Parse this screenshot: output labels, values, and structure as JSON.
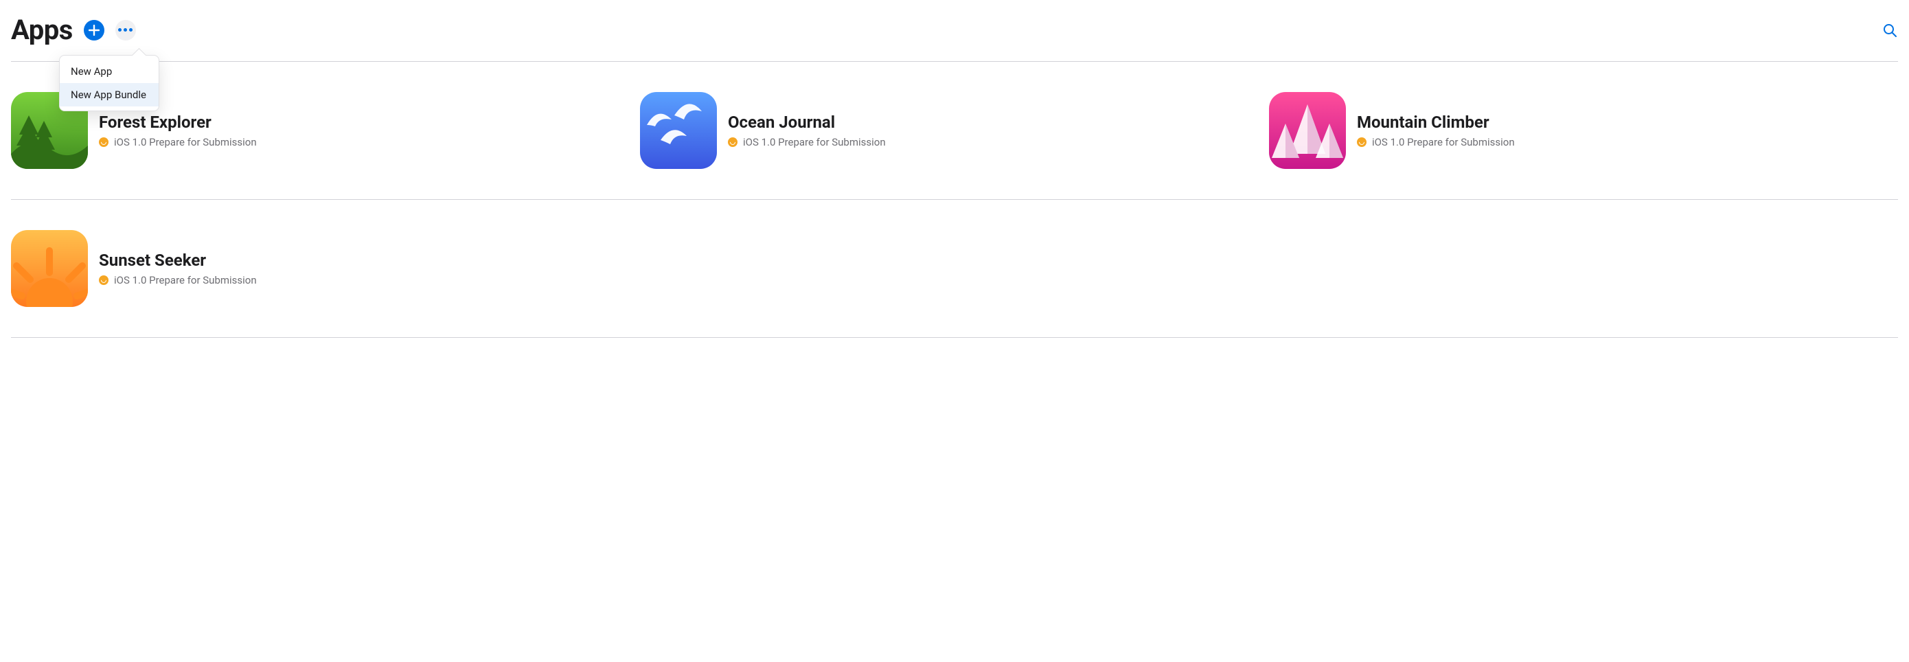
{
  "header": {
    "title": "Apps"
  },
  "dropdown": {
    "items": [
      {
        "label": "New App",
        "highlight": false
      },
      {
        "label": "New App Bundle",
        "highlight": true
      }
    ]
  },
  "apps": [
    {
      "name": "Forest Explorer",
      "status": "iOS 1.0 Prepare for Submission",
      "iconClass": "icon-forest",
      "statusColor": "#f5a623"
    },
    {
      "name": "Ocean Journal",
      "status": "iOS 1.0 Prepare for Submission",
      "iconClass": "icon-ocean",
      "statusColor": "#f5a623"
    },
    {
      "name": "Mountain Climber",
      "status": "iOS 1.0 Prepare for Submission",
      "iconClass": "icon-mountain",
      "statusColor": "#f5a623"
    },
    {
      "name": "Sunset Seeker",
      "status": "iOS 1.0 Prepare for Submission",
      "iconClass": "icon-sunset",
      "statusColor": "#f5a623"
    }
  ]
}
